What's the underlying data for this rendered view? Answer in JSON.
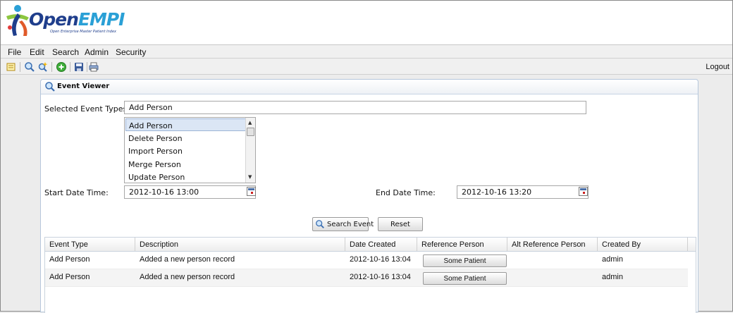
{
  "app": {
    "logo_name_part1": "Open",
    "logo_name_part2": "EMPI",
    "logo_tagline": "Open Enterprise Master Patient Index"
  },
  "menu": [
    "File",
    "Edit",
    "Search",
    "Admin",
    "Security"
  ],
  "toolbar": {
    "icons": [
      "report-icon",
      "search-icon",
      "advanced-search-icon",
      "add-person-icon",
      "save-icon",
      "print-icon"
    ],
    "logout_label": "Logout"
  },
  "panel": {
    "title": "Event Viewer"
  },
  "form": {
    "selected_event_types_label": "Selected Event Types:",
    "selected_event_types_value": "Add Person",
    "event_types": [
      "Add Person",
      "Delete Person",
      "Import Person",
      "Merge Person",
      "Update Person"
    ],
    "selected_event_type_index": 0,
    "start_label": "Start Date Time:",
    "start_value": "2012-10-16 13:00",
    "end_label": "End Date Time:",
    "end_value": "2012-10-16 13:20",
    "search_button": "Search Event",
    "reset_button": "Reset"
  },
  "grid": {
    "columns": [
      "Event Type",
      "Description",
      "Date Created",
      "Reference Person",
      "Alt Reference Person",
      "Created By"
    ],
    "rows": [
      {
        "event_type": "Add Person",
        "description": "Added a new person record",
        "date_created": "2012-10-16 13:04",
        "reference_person": "Some Patient",
        "alt_reference_person": "",
        "created_by": "admin"
      },
      {
        "event_type": "Add Person",
        "description": "Added a new person record",
        "date_created": "2012-10-16 13:04",
        "reference_person": "Some Patient",
        "alt_reference_person": "",
        "created_by": "admin"
      }
    ]
  }
}
